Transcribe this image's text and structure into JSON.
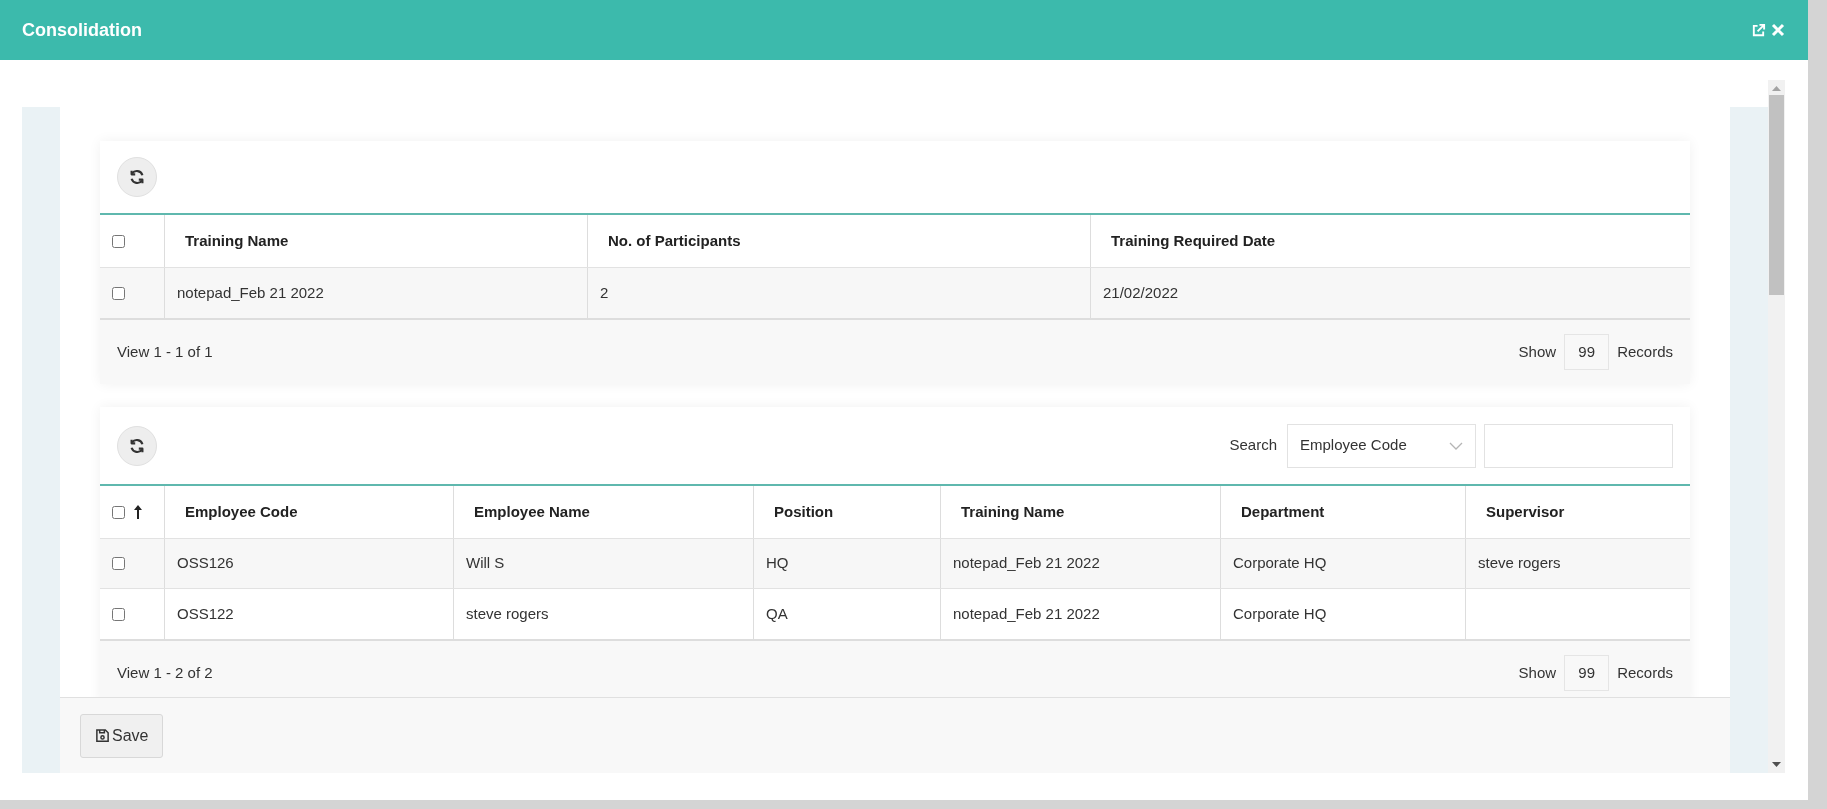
{
  "window": {
    "title": "Consolidation"
  },
  "training_table": {
    "header_checked": false,
    "columns": [
      "Training Name",
      "No. of Participants",
      "Training Required Date"
    ],
    "rows": [
      {
        "checked": false,
        "cells": [
          "notepad_Feb 21 2022",
          "2",
          "21/02/2022"
        ]
      }
    ],
    "pager": {
      "summary": "View 1 - 1 of 1",
      "show_label": "Show",
      "page_size": "99",
      "records_label": "Records"
    }
  },
  "employee_table": {
    "header_checked": false,
    "search": {
      "label": "Search",
      "field": "Employee Code"
    },
    "columns": [
      "Employee Code",
      "Employee Name",
      "Position",
      "Training Name",
      "Department",
      "Supervisor"
    ],
    "rows": [
      {
        "checked": false,
        "cells": [
          "OSS126",
          "Will S",
          "HQ",
          "notepad_Feb 21 2022",
          "Corporate HQ",
          "steve rogers"
        ]
      },
      {
        "checked": false,
        "cells": [
          "OSS122",
          "steve rogers",
          "QA",
          "notepad_Feb 21 2022",
          "Corporate HQ"
        ]
      }
    ],
    "pager": {
      "summary": "View 1 - 2 of 2",
      "show_label": "Show",
      "page_size": "99",
      "records_label": "Records"
    }
  },
  "footer": {
    "buttons": [
      "Save"
    ]
  }
}
